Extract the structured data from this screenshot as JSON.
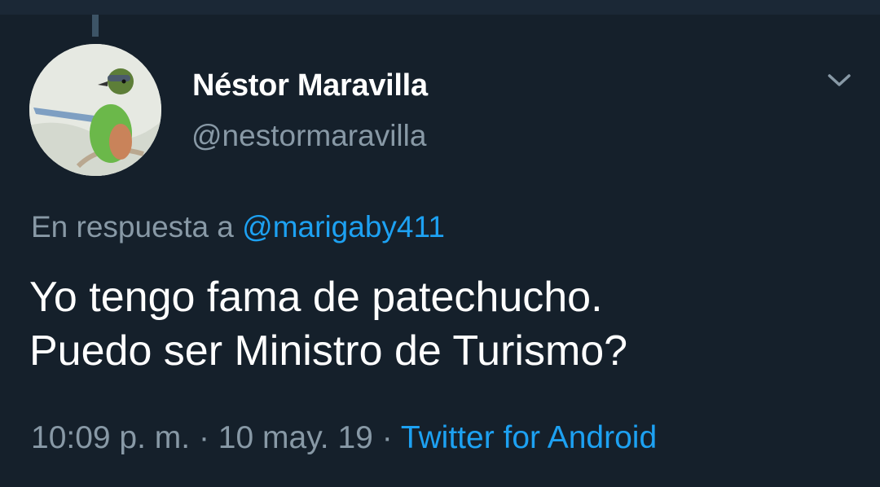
{
  "tweet": {
    "author_name": "Néstor Maravilla",
    "author_handle": "@nestormaravilla",
    "reply_prefix": "En respuesta a",
    "reply_to": "@marigaby411",
    "text_lines": [
      "Yo tengo fama de patechucho.",
      "Puedo ser Ministro de Turismo?"
    ],
    "time": "10:09 p. m.",
    "separator": " · ",
    "date": "10 may. 19",
    "source": "Twitter for Android"
  },
  "icons": {
    "menu": "chevron-down-icon",
    "avatar": "bird-avatar"
  },
  "colors": {
    "background": "#15202b",
    "text": "#ffffff",
    "secondary": "#8899a6",
    "accent": "#1da1f2"
  }
}
